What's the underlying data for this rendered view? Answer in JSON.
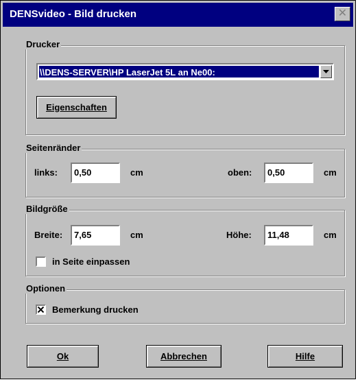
{
  "title": "DENSvideo - Bild drucken",
  "close_symbol": "✕",
  "printer": {
    "legend": "Drucker",
    "selected": "\\\\DENS-SERVER\\HP LaserJet 5L an Ne00:",
    "properties_button": "Eigenschaften"
  },
  "margins": {
    "legend": "Seitenränder",
    "left_label": "links:",
    "left_value": "0,50",
    "left_unit": "cm",
    "top_label": "oben:",
    "top_value": "0,50",
    "top_unit": "cm"
  },
  "image_size": {
    "legend": "Bildgröße",
    "width_label": "Breite:",
    "width_value": "7,65",
    "width_unit": "cm",
    "height_label": "Höhe:",
    "height_value": "11,48",
    "height_unit": "cm",
    "fit_label": "in Seite einpassen",
    "fit_checked": false
  },
  "options": {
    "legend": "Optionen",
    "remark_label": "Bemerkung drucken",
    "remark_checked": true
  },
  "buttons": {
    "ok": "Ok",
    "cancel": "Abbrechen",
    "help": "Hilfe"
  }
}
